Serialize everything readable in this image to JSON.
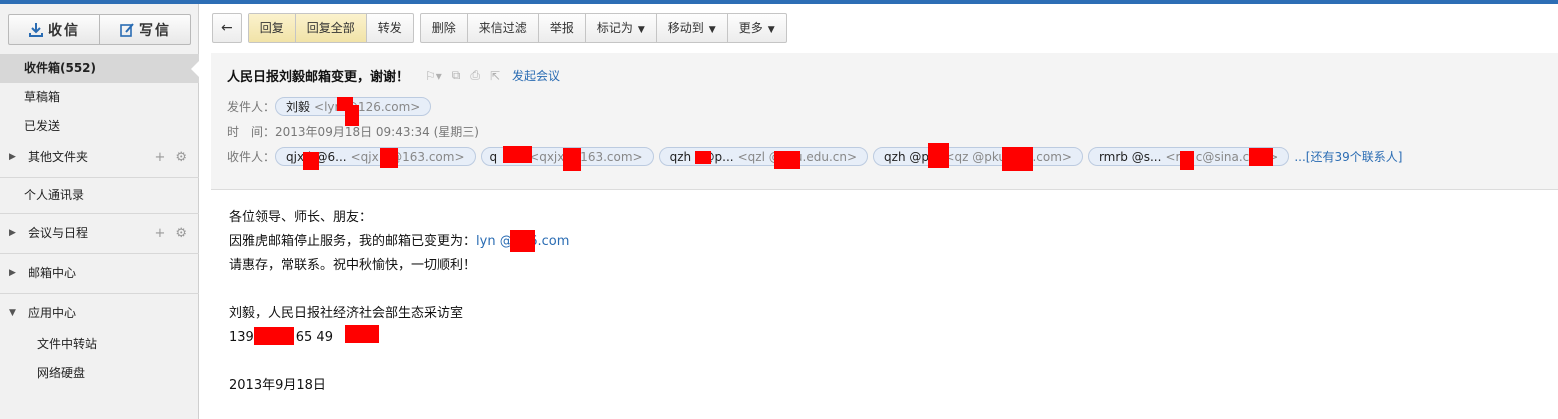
{
  "sidebar": {
    "receive_label": "收信",
    "compose_label": "写信",
    "nav": {
      "inbox": "收件箱(552)",
      "drafts": "草稿箱",
      "sent": "已发送",
      "other_folders": "其他文件夹",
      "contacts": "个人通讯录",
      "calendar": "会议与日程",
      "mail_center": "邮箱中心",
      "app_center": "应用中心",
      "file_transfer": "文件中转站",
      "net_disk": "网络硬盘"
    }
  },
  "toolbar": {
    "back_icon": "←",
    "reply": "回复",
    "reply_all": "回复全部",
    "forward": "转发",
    "delete": "删除",
    "filter": "来信过滤",
    "report": "举报",
    "mark_as": "标记为",
    "move_to": "移动到",
    "more": "更多"
  },
  "header": {
    "subject": "人民日报刘毅邮箱变更，谢谢！",
    "start_meeting": "发起会议",
    "sender_label": "发件人：",
    "sender_name": "刘毅",
    "sender_addr": "<lyn  @126.com>",
    "time_label": "时　间：",
    "time_value": "2013年09月18日 09:43:34 (星期三)",
    "recipients_label": "收件人：",
    "recipients": [
      {
        "name": "qjx  b@6...",
        "addr": "<qjx  p@163.com>"
      },
      {
        "name": "q",
        "addr": "<qxjx  @163.com>"
      },
      {
        "name": "qzh  g@p...",
        "addr": "<qzl  @pku.edu.cn>"
      },
      {
        "name": "qzh  @p...",
        "addr": "<qz  @pku.edu.com>"
      },
      {
        "name": "rmrb  @s...",
        "addr": "<rm  c@sina.com>"
      }
    ],
    "more_contacts": "...[还有39个联系人]"
  },
  "body": {
    "greeting": "各位领导、师长、朋友：",
    "line2_prefix": "因雅虎邮箱停止服务，我的邮箱已变更为：",
    "line2_email": "lyn  @126.com",
    "line3": "请惠存，常联系。祝中秋愉快，一切顺利！",
    "signature": "刘毅，人民日报社经济社会部生态采访室",
    "phones": "139       721，65      49",
    "date": "2013年9月18日"
  },
  "colors": {
    "accent_blue": "#2d6eb5",
    "link_blue": "#2a6cb3",
    "highlight_button": "#f1e3a8",
    "redaction": "#ff0000"
  }
}
